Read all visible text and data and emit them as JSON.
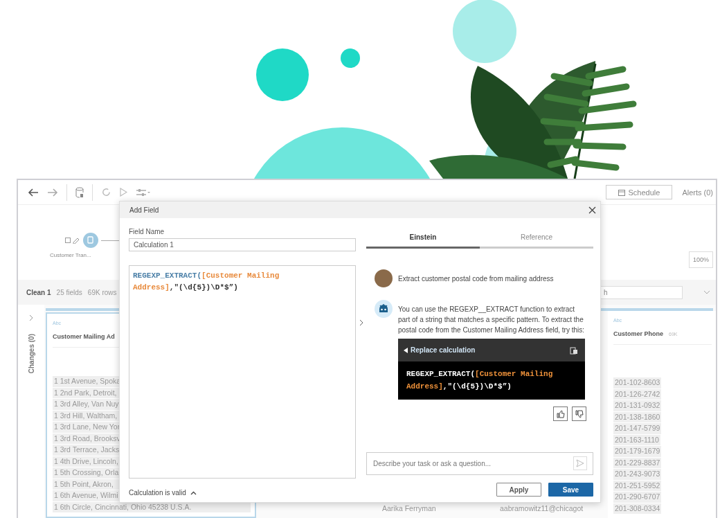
{
  "toolbar": {
    "schedule": "Schedule",
    "alerts": "Alerts (0)"
  },
  "flow": {
    "node_label": "Customer Tran...",
    "zoom": "100%"
  },
  "clean_bar": {
    "step": "Clean 1",
    "fields": "25 fields",
    "rows": "69K rows",
    "search_placeholder": "h"
  },
  "changes_panel": {
    "label": "Changes (0)"
  },
  "columns": [
    {
      "type_label": "Abc",
      "name": "Customer Mailing Ad",
      "selected": true,
      "values": [
        "1 1st Avenue, Spoka",
        "1 2nd Park, Detroit,",
        "1 3rd Alley, Van Nuy",
        "1 3rd Hill, Waltham,",
        "1 3rd Lane, New Yor",
        "1 3rd Road, Brooksv",
        "1 3rd Terrace, Jacks",
        "1 4th Drive, Lincoln,",
        "1 5th Crossing, Orla",
        "1 5th Point, Akron,",
        "1 6th Avenue, Wilmi",
        "1 6th Circle, Cincinnati, Ohio 45238 U.S.A."
      ]
    },
    {
      "selected": false,
      "values": [
        "Aarika Ferryman"
      ]
    },
    {
      "selected": false,
      "values": [
        "aabramowitz11@chicagot"
      ]
    },
    {
      "type_label": "Abc",
      "name": "Customer Phone",
      "count": "69K",
      "selected": false,
      "values": [
        "201-102-8603",
        "201-126-2742",
        "201-131-0932",
        "201-138-1860",
        "201-147-5799",
        "201-163-1110",
        "201-179-1679",
        "201-229-8837",
        "201-243-9073",
        "201-251-5952",
        "201-290-6707",
        "201-308-0334"
      ]
    }
  ],
  "dialog": {
    "title": "Add Field",
    "field_name_label": "Field Name",
    "field_name": "Calculation 1",
    "calculation": [
      {
        "kind": "function",
        "text": "REGEXP_EXTRACT("
      },
      {
        "kind": "field",
        "text": "[Customer Mailing Address]"
      },
      {
        "kind": "plain",
        "text": ",\"(\\d{5})\\D*$”)"
      }
    ],
    "status": "Calculation is valid",
    "tabs": [
      {
        "label": "Einstein",
        "selected": true
      },
      {
        "label": "Reference",
        "selected": false
      }
    ],
    "messages": [
      {
        "kind": "user",
        "text": "Extract customer postal code from mailing address"
      },
      {
        "kind": "assistant",
        "text": "You can use the REGEXP__EXTRACT function to extract part of a string that matches a specific pattern. To extract the postal code from the Customer Mailing Address field, try this:",
        "suggestion": {
          "title": "Replace calculation",
          "code": [
            {
              "kind": "function",
              "text": "REGEXP_EXTRACT("
            },
            {
              "kind": "field",
              "text": "[Customer Mailing Address]"
            },
            {
              "kind": "plain",
              "text": ",\"(\\d{5})\\D*$”)"
            }
          ]
        }
      }
    ],
    "prompt": {
      "placeholder": "Describe your task or ask a question..."
    },
    "buttons": [
      {
        "label": "Apply",
        "kind": "secondary"
      },
      {
        "label": "Save",
        "kind": "primary"
      }
    ]
  }
}
